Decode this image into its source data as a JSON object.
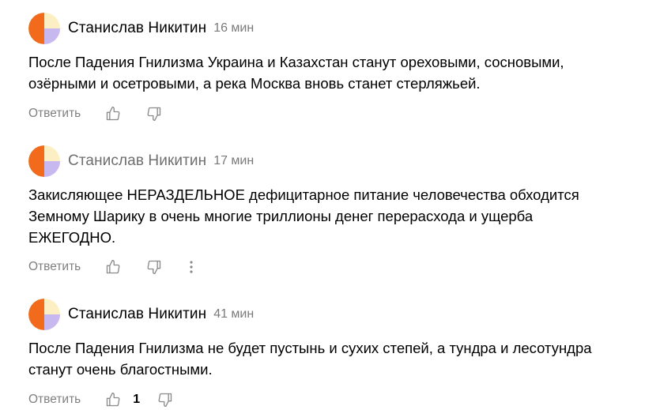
{
  "comments": [
    {
      "author": "Станислав Никитин",
      "time": "16 мин",
      "text": "После Падения Гнилизма Украина и Казахстан станут ореховыми, сосновыми,\nозёрными и осетровыми, а река Москва вновь станет стерляжьей.",
      "reply_label": "Ответить",
      "likes": ""
    },
    {
      "author": "Станислав Никитин",
      "time": "17 мин",
      "text": "Закисляющее НЕРАЗДЕЛЬНОЕ дефицитарное питание человечества обходится\nЗемному Шарику в очень многие триллионы денег перерасхода и ущерба\nЕЖЕГОДНО.",
      "reply_label": "Ответить",
      "likes": ""
    },
    {
      "author": "Станислав Никитин",
      "time": "41 мин",
      "text": "После Падения Гнилизма не будет пустынь и сухих степей, а тундра и лесотундра\nстанут очень благостными.",
      "reply_label": "Ответить",
      "likes": "1"
    }
  ],
  "icons": {
    "avatar": "avatar-icon",
    "like": "thumbs-up-icon",
    "dislike": "thumbs-down-icon",
    "more": "more-vertical-icon"
  },
  "colors": {
    "avatar_orange": "#f26b1d",
    "avatar_cream": "#fcefc4",
    "avatar_lavender": "#c8b8f0",
    "muted_text": "#808080",
    "time_text": "#7a7a7a"
  }
}
